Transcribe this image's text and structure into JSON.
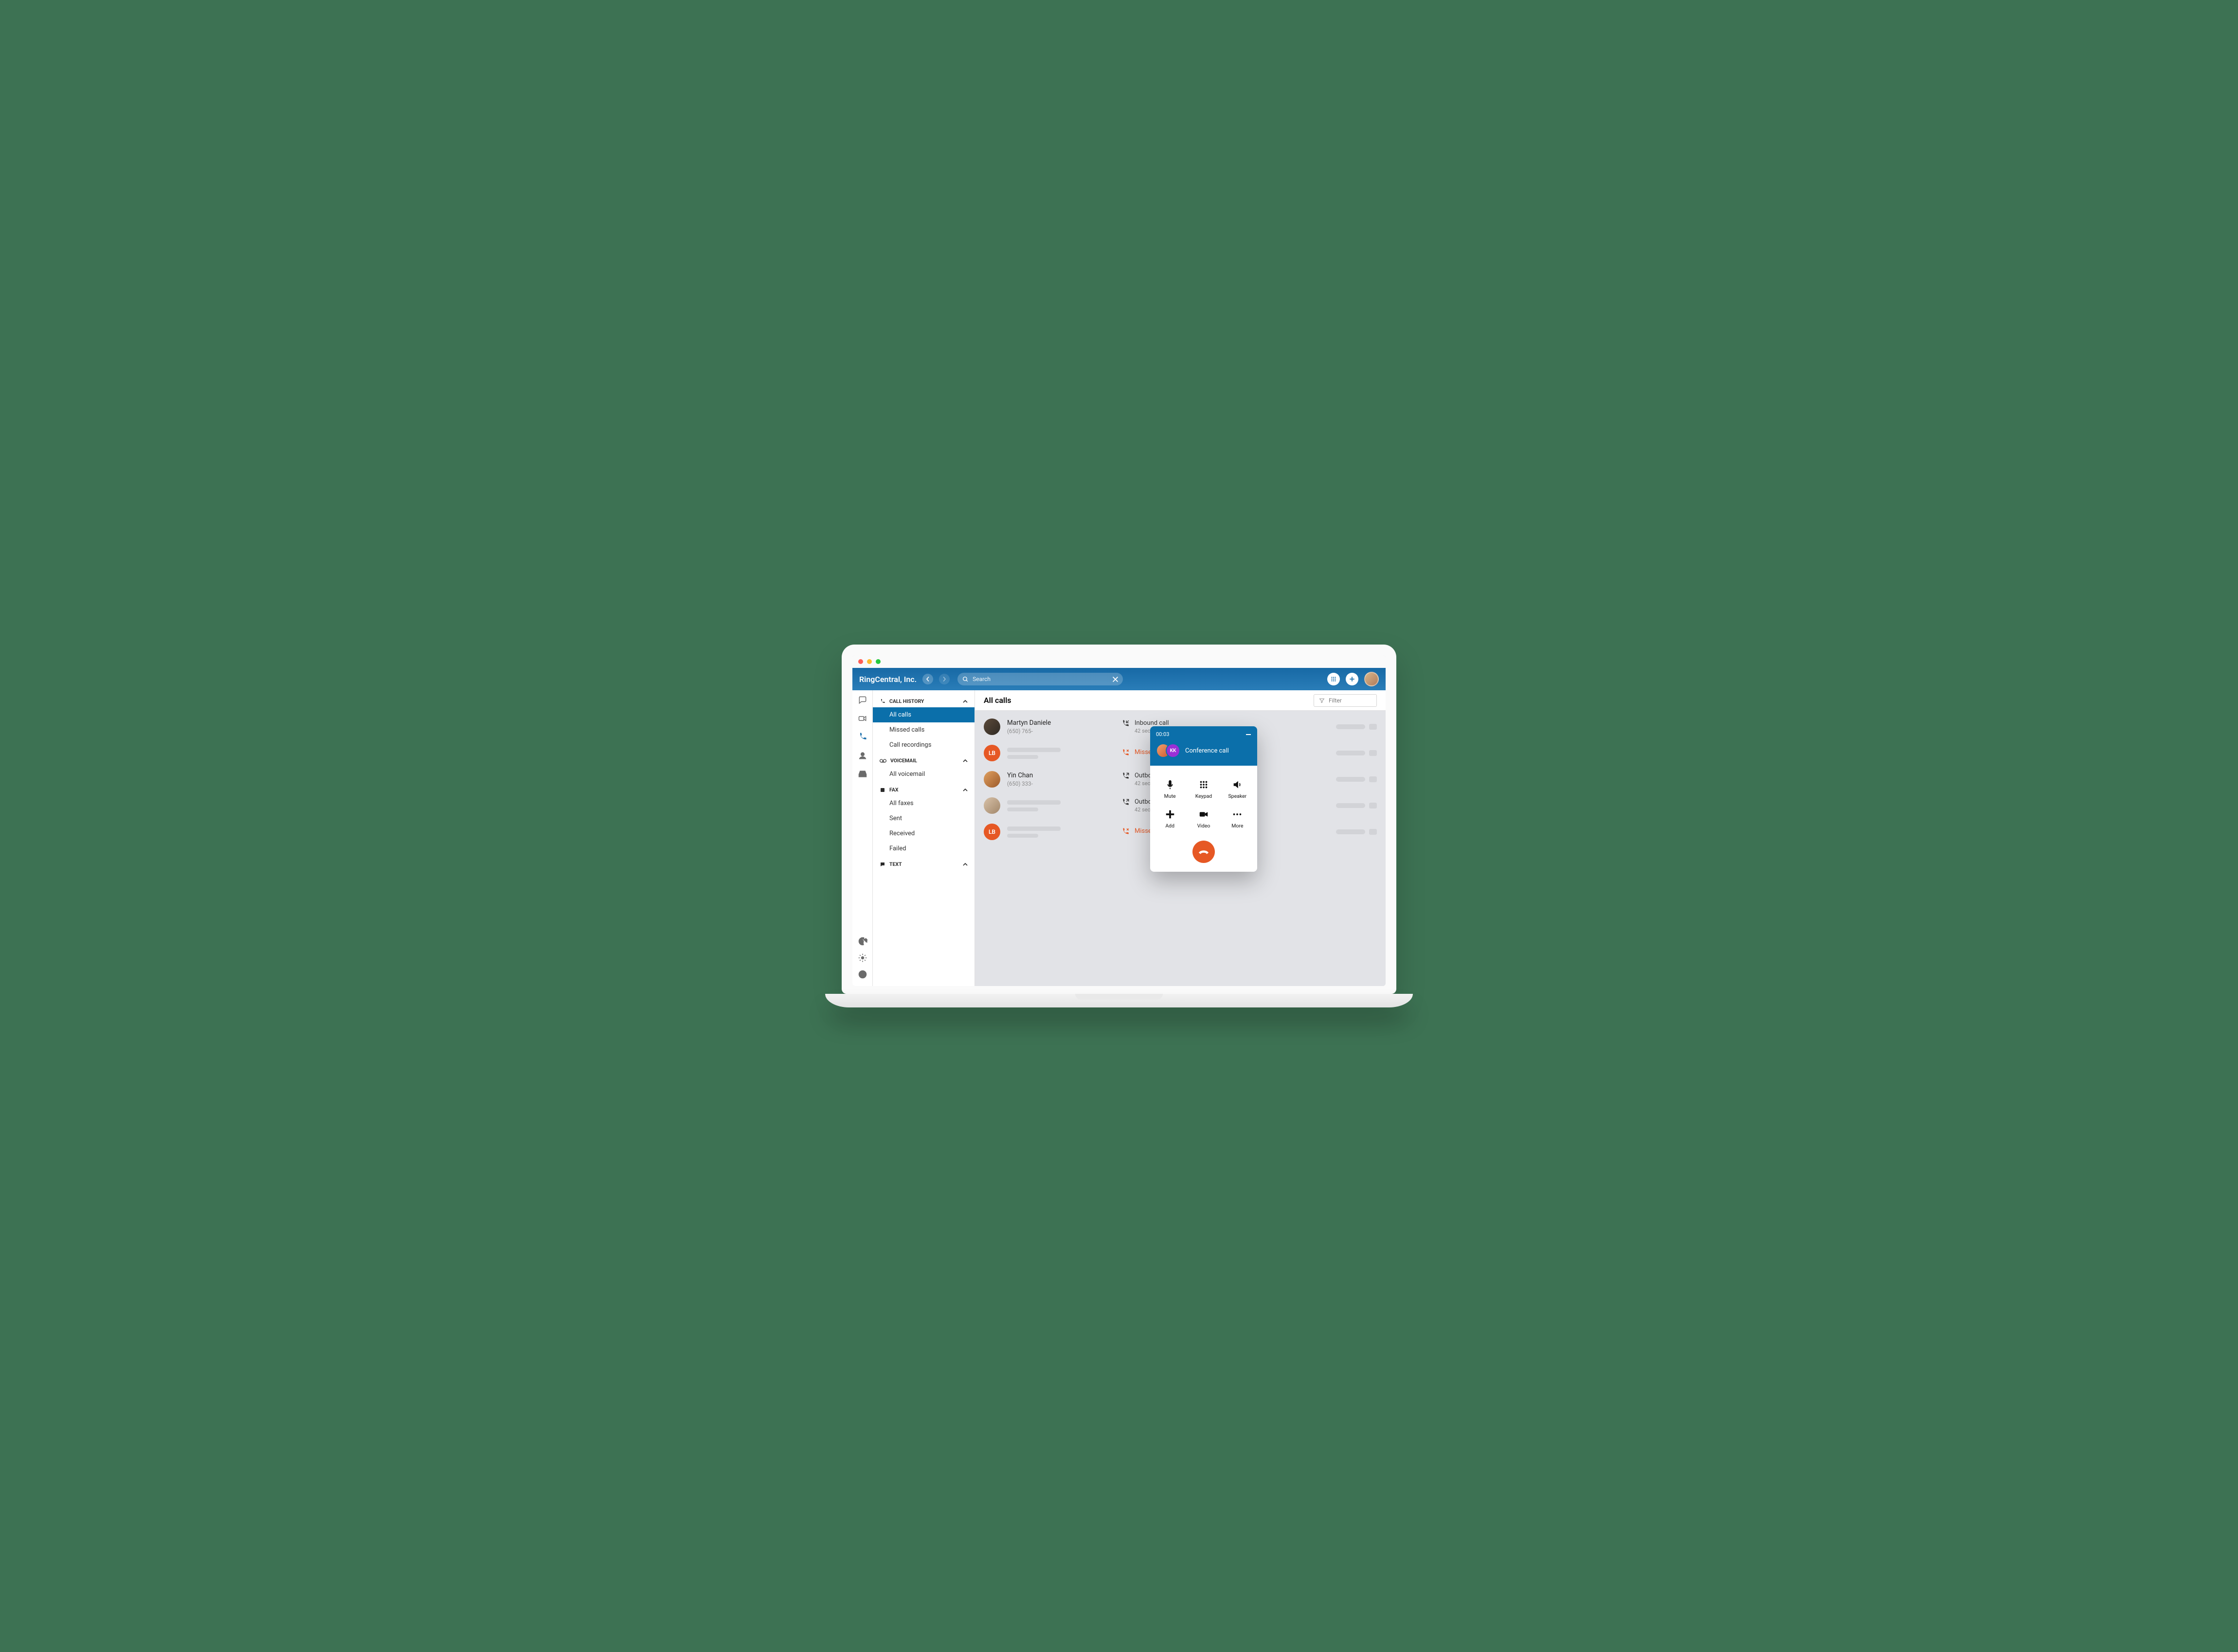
{
  "header": {
    "brand": "RingCentral, Inc.",
    "search_placeholder": "Search"
  },
  "sidebar": {
    "sections": [
      {
        "title": "CALL HISTORY",
        "items": [
          "All calls",
          "Missed calls",
          "Call recordings"
        ],
        "selected": 0
      },
      {
        "title": "VOICEMAIL",
        "items": [
          "All voicemail"
        ]
      },
      {
        "title": "FAX",
        "items": [
          "All faxes",
          "Sent",
          "Received",
          "Failed"
        ]
      },
      {
        "title": "TEXT",
        "items": []
      }
    ]
  },
  "main": {
    "title": "All calls",
    "filter_label": "Filter",
    "rows": [
      {
        "avatar": {
          "type": "img",
          "cls": "img1"
        },
        "name": "Martyn Daniele",
        "phone": "(650) 765-",
        "kind": "Inbound call",
        "dur": "42 sec",
        "missed": false
      },
      {
        "avatar": {
          "type": "initials",
          "text": "LB"
        },
        "name": null,
        "phone": null,
        "kind": "Missed call",
        "dur": "",
        "missed": true
      },
      {
        "avatar": {
          "type": "img",
          "cls": "img2"
        },
        "name": "Yin Chan",
        "phone": "(650) 333-",
        "kind": "Outbound call",
        "dur": "42 sec",
        "missed": false
      },
      {
        "avatar": {
          "type": "img",
          "cls": "img3"
        },
        "name": null,
        "phone": null,
        "kind": "Outbound call",
        "dur": "42 sec",
        "missed": false
      },
      {
        "avatar": {
          "type": "initials",
          "text": "LB"
        },
        "name": null,
        "phone": null,
        "kind": "Missed call",
        "dur": "",
        "missed": true
      }
    ]
  },
  "call_window": {
    "timer": "00:03",
    "participant_initials": "KK",
    "title": "Conference call",
    "buttons": [
      "Mute",
      "Keypad",
      "Speaker",
      "Add",
      "Video",
      "More"
    ]
  },
  "colors": {
    "accent": "#0b6faa",
    "orange": "#e65824"
  }
}
